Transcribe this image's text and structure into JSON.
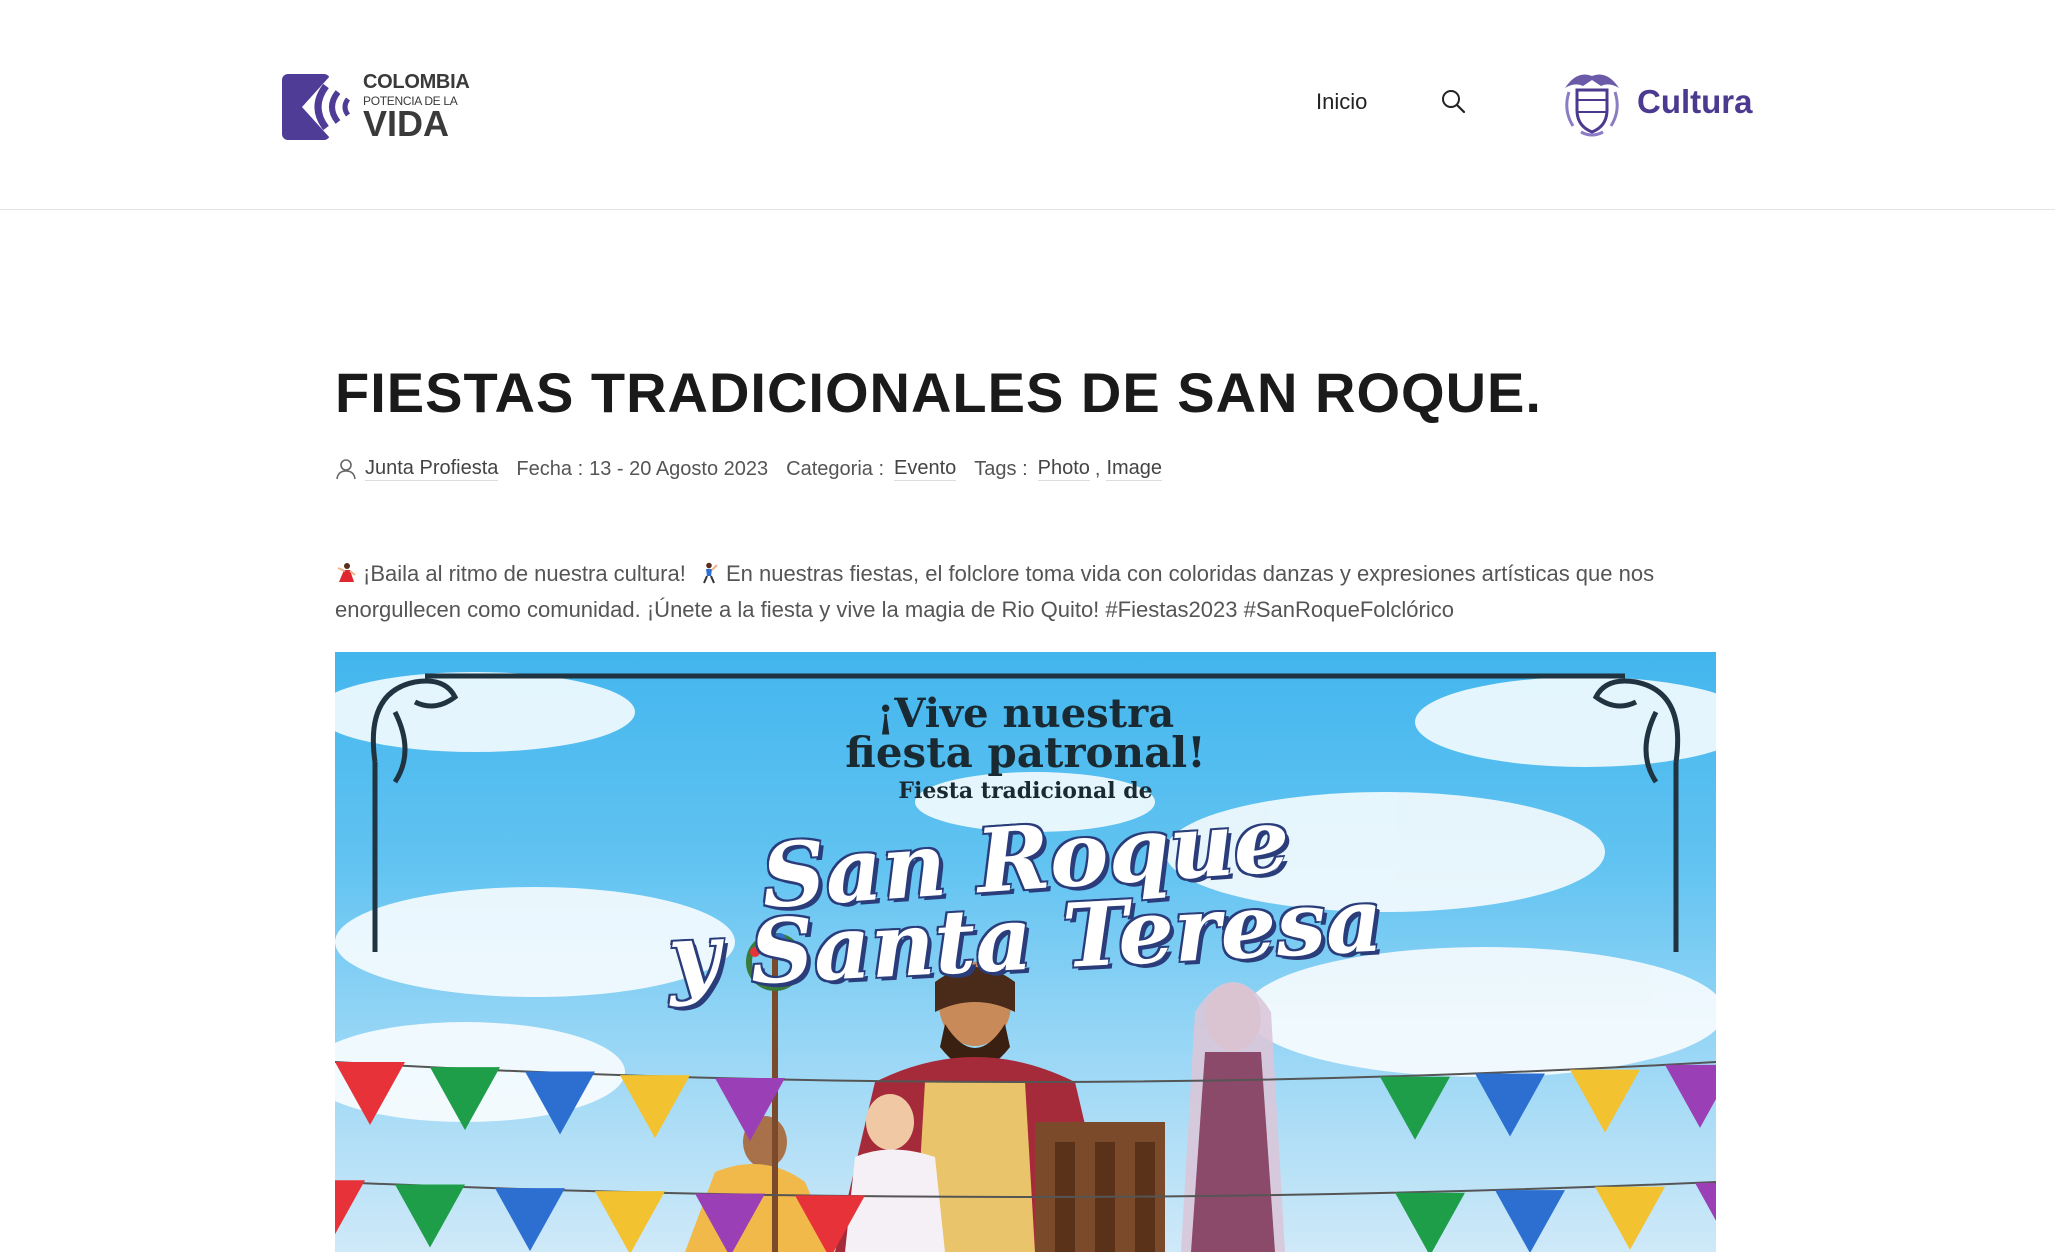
{
  "header": {
    "logo_colombia": {
      "line1": "COLOMBIA",
      "line2": "POTENCIA DE LA",
      "line3": "VIDA"
    },
    "nav": {
      "inicio": "Inicio"
    },
    "logo_cultura": {
      "text": "Cultura"
    },
    "colors": {
      "brand_purple": "#4b3a8f",
      "logo_purple": "#4f3c96"
    }
  },
  "article": {
    "title": "FIESTAS TRADICIONALES DE SAN ROQUE.",
    "meta": {
      "author": "Junta Profiesta",
      "date_label": "Fecha :",
      "date_value": "13 - 20 Agosto 2023",
      "category_label": "Categoria :",
      "category_value": "Evento",
      "tags_label": "Tags :",
      "tags": [
        "Photo",
        "Image"
      ],
      "tags_separator": ","
    },
    "body_part1": "¡Baila al ritmo de nuestra cultura!",
    "body_part2": "En nuestras fiestas, el folclore toma vida con coloridas danzas y expresiones artísticas que nos enorgullecen como comunidad. ¡Únete a la fiesta y vive la magia de Rio Quito! #Fiestas2023 #SanRoqueFolclórico"
  },
  "poster": {
    "line1": "¡Vive nuestra",
    "line2": "fiesta patronal!",
    "line3": "Fiesta tradicional de",
    "line4": "San Roque",
    "line5": "y Santa Teresa",
    "flag_colors": [
      "#e8323a",
      "#1e9e49",
      "#2c6fd1",
      "#f2c230",
      "#9b3fb6",
      "#e8323a",
      "#1e9e49",
      "#2c6fd1",
      "#f2c230",
      "#9b3fb6"
    ]
  }
}
